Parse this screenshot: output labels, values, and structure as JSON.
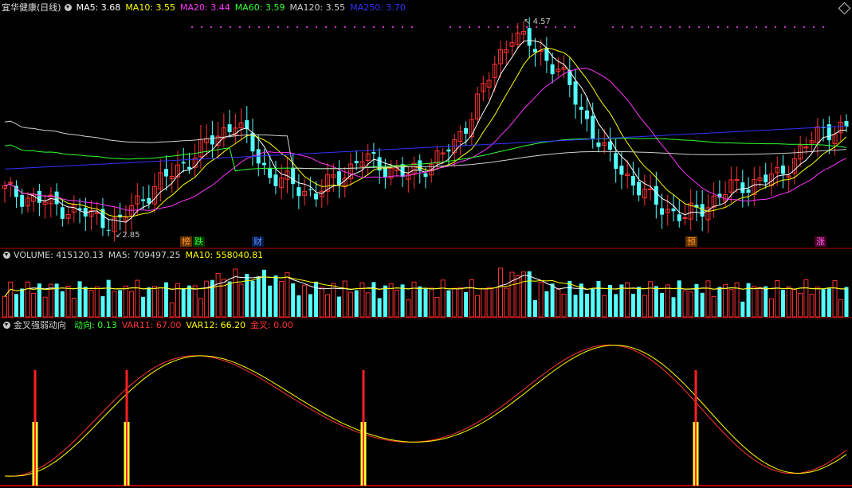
{
  "stock": {
    "name": "宜华健康(日线)"
  },
  "ma_legend": [
    {
      "key": "ma5",
      "text": "MA5: 3.68",
      "color": "#ffffff"
    },
    {
      "key": "ma10",
      "text": "MA10: 3.55",
      "color": "#ffff00"
    },
    {
      "key": "ma20",
      "text": "MA20: 3.44",
      "color": "#ff33ff"
    },
    {
      "key": "ma60",
      "text": "MA60: 3.59",
      "color": "#33ff33"
    },
    {
      "key": "ma120",
      "text": "MA120: 3.55",
      "color": "#d0d0d0"
    },
    {
      "key": "ma250",
      "text": "MA250: 3.70",
      "color": "#3333ff"
    }
  ],
  "price_labels": {
    "high": "4.57",
    "low": "2.85"
  },
  "event_tags": [
    {
      "text": "榜",
      "color": "#ff9933",
      "bg": "#663300"
    },
    {
      "text": "跌",
      "color": "#33ff33",
      "bg": "#003300"
    },
    {
      "text": "财",
      "color": "#6699ff",
      "bg": "#001a4d"
    },
    {
      "text": "预",
      "color": "#ff9933",
      "bg": "#663300"
    },
    {
      "text": "涨",
      "color": "#ff66ff",
      "bg": "#4d0026"
    }
  ],
  "volume_legend": [
    {
      "key": "volume",
      "text": "VOLUME: 415120.13",
      "color": "#d0d0d0"
    },
    {
      "key": "vma5",
      "text": "MA5: 709497.25",
      "color": "#d0d0d0"
    },
    {
      "key": "vma10",
      "text": "MA10: 558040.81",
      "color": "#ffff00"
    }
  ],
  "indicator_legend": {
    "name": "金叉强弱动向",
    "items": [
      {
        "key": "dongxiang",
        "text": "动向: 0.13",
        "color": "#33ff33"
      },
      {
        "key": "var11",
        "text": "VAR11: 67.00",
        "color": "#ff3333"
      },
      {
        "key": "var12",
        "text": "VAR12: 66.20",
        "color": "#ffff00"
      },
      {
        "key": "jincha",
        "text": "金叉: 0.00",
        "color": "#ff3333"
      }
    ]
  },
  "colors": {
    "up": "#ff3232",
    "down": "#54ffff",
    "grid": "#b40000",
    "bg": "#000000"
  },
  "chart_data": [
    {
      "type": "candlestick",
      "title": "宜华健康(日线)",
      "note": "price series, approx. 147 daily bars; low 2.85, high 4.57",
      "ohlc_keypoints": [
        {
          "bar": 0,
          "close": 3.18
        },
        {
          "bar": 20,
          "close": 2.9
        },
        {
          "bar": 22,
          "close": 3.05
        },
        {
          "bar": 40,
          "close": 3.76
        },
        {
          "bar": 46,
          "close": 3.3
        },
        {
          "bar": 54,
          "close": 3.15
        },
        {
          "bar": 62,
          "close": 3.45
        },
        {
          "bar": 70,
          "close": 3.3
        },
        {
          "bar": 78,
          "close": 3.55
        },
        {
          "bar": 88,
          "close": 4.5
        },
        {
          "bar": 96,
          "close": 4.2
        },
        {
          "bar": 104,
          "close": 3.5
        },
        {
          "bar": 112,
          "close": 3.1
        },
        {
          "bar": 118,
          "close": 2.95
        },
        {
          "bar": 126,
          "close": 3.2
        },
        {
          "bar": 134,
          "close": 3.3
        },
        {
          "bar": 142,
          "close": 3.7
        },
        {
          "bar": 146,
          "close": 3.68
        }
      ],
      "series": [
        {
          "name": "MA5",
          "value": 3.68
        },
        {
          "name": "MA10",
          "value": 3.55
        },
        {
          "name": "MA20",
          "value": 3.44
        },
        {
          "name": "MA60",
          "value": 3.59
        },
        {
          "name": "MA120",
          "value": 3.55
        },
        {
          "name": "MA250",
          "value": 3.7
        }
      ]
    },
    {
      "type": "bar",
      "title": "VOLUME",
      "latest": 415120.13,
      "series": [
        {
          "name": "MA5",
          "value": 709497.25
        },
        {
          "name": "MA10",
          "value": 558040.81
        }
      ]
    },
    {
      "type": "line",
      "title": "金叉强弱动向",
      "ylim": [
        0,
        100
      ],
      "series": [
        {
          "name": "VAR11",
          "latest": 67.0
        },
        {
          "name": "VAR12",
          "latest": 66.2
        }
      ],
      "golden_cross_bars": [
        5,
        21,
        62,
        119
      ]
    }
  ]
}
